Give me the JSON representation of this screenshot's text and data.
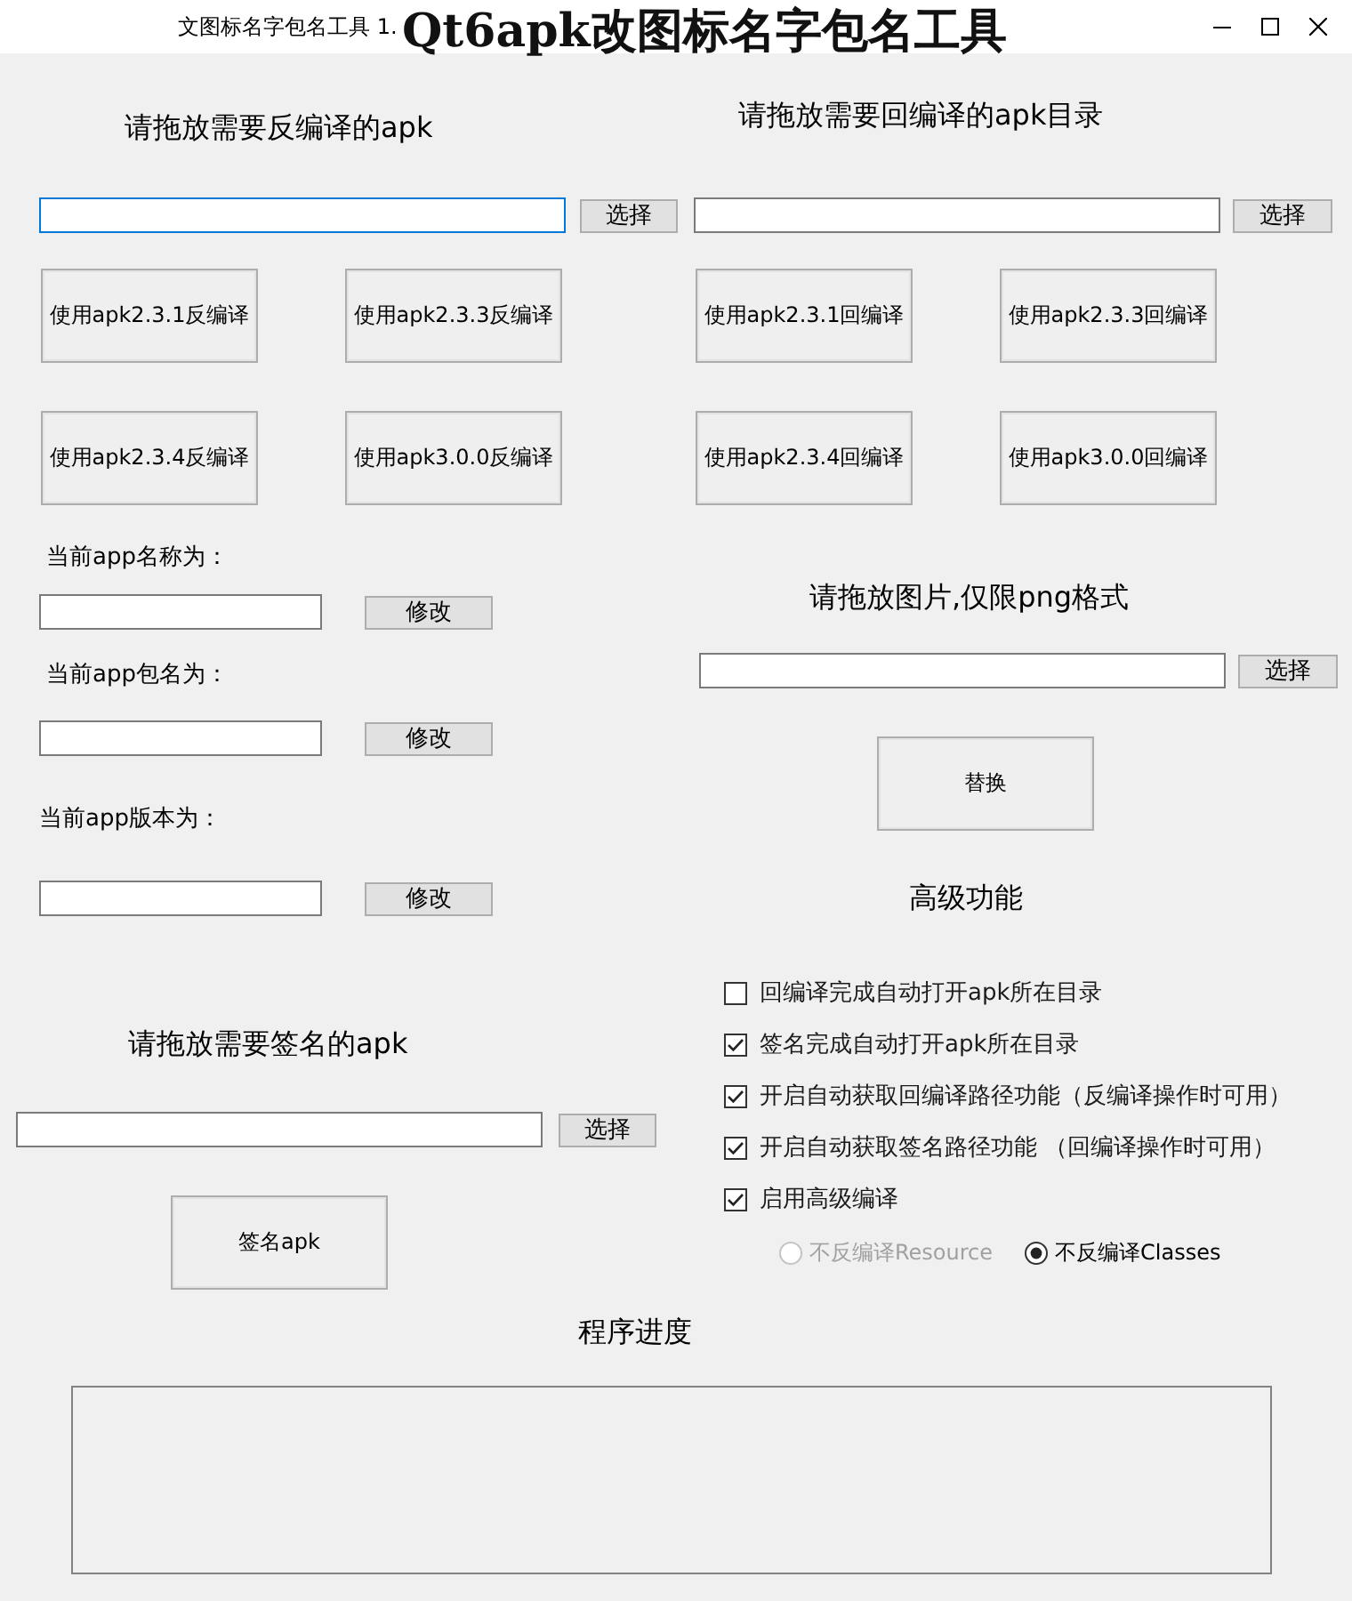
{
  "window": {
    "title": "文图标名字包名工具 1.",
    "banner": "Qt6apk改图标名字包名工具"
  },
  "decompile": {
    "heading": "请拖放需要反编译的apk",
    "field": {
      "focused": true
    },
    "browse_button": "选择",
    "buttons": [
      "使用apk2.3.1反编译",
      "使用apk2.3.3反编译",
      "使用apk2.3.4反编译",
      "使用apk3.0.0反编译"
    ]
  },
  "app_info": [
    {
      "label": "当前app名称为：",
      "field": {
        "focused": false
      },
      "button": "修改"
    },
    {
      "label": "当前app包名为：",
      "field": {
        "focused": false
      },
      "button": "修改"
    },
    {
      "label": "当前app版本为：",
      "field": {
        "focused": false
      },
      "button": "修改"
    }
  ],
  "sign": {
    "heading": "请拖放需要签名的apk",
    "field": {
      "focused": false
    },
    "browse_button": "选择",
    "sign_button": "签名apk"
  },
  "recompile": {
    "heading": "请拖放需要回编译的apk目录",
    "field": {
      "focused": false
    },
    "browse_button": "选择",
    "buttons": [
      "使用apk2.3.1回编译",
      "使用apk2.3.3回编译",
      "使用apk2.3.4回编译",
      "使用apk3.0.0回编译"
    ]
  },
  "icon_replace": {
    "heading": "请拖放图片,仅限png格式",
    "field": {
      "focused": false
    },
    "browse_button": "选择",
    "replace_button": "替换"
  },
  "advanced": {
    "heading": "高级功能",
    "options": [
      {
        "label": "回编译完成自动打开apk所在目录",
        "checked": false
      },
      {
        "label": "签名完成自动打开apk所在目录",
        "checked": true
      },
      {
        "label": "开启自动获取回编译路径功能（反编译操作时可用）",
        "checked": true
      },
      {
        "label": "开启自动获取签名路径功能 （回编译操作时可用）",
        "checked": true
      },
      {
        "label": "启用高级编译",
        "checked": true
      }
    ],
    "radios": [
      {
        "label": "不反编译Resource",
        "selected": false,
        "disabled": true
      },
      {
        "label": "不反编译Classes",
        "selected": true,
        "disabled": false
      }
    ]
  },
  "progress": {
    "heading": "程序进度"
  }
}
